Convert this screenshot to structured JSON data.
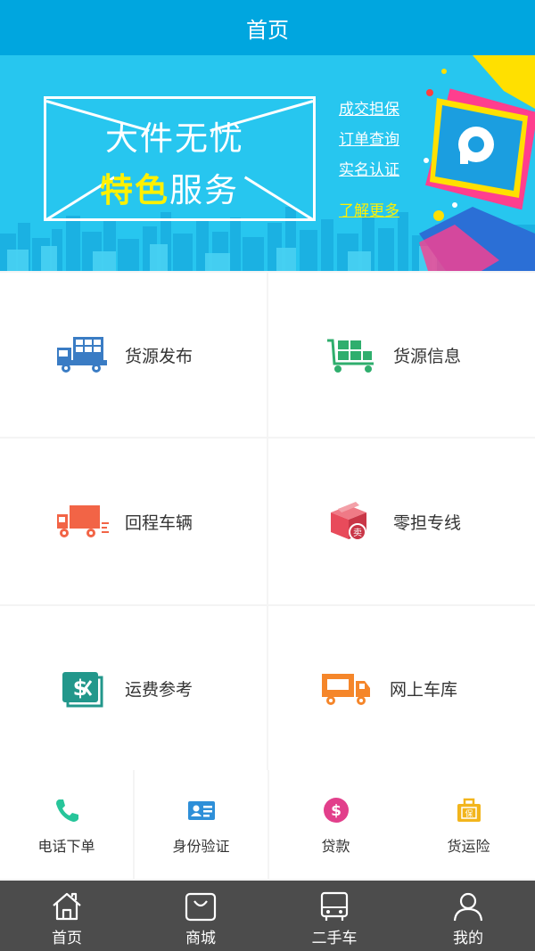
{
  "header": {
    "title": "首页"
  },
  "banner": {
    "title": "大件无忧",
    "subtitle_highlight": "特色",
    "subtitle_rest": "服务",
    "links": [
      "成交担保",
      "订单查询",
      "实名认证"
    ],
    "more": "了解更多"
  },
  "services": [
    {
      "label": "货源发布",
      "icon": "truck-cargo-icon",
      "color": "#3a7cc4"
    },
    {
      "label": "货源信息",
      "icon": "cart-boxes-icon",
      "color": "#2fae6d"
    },
    {
      "label": "回程车辆",
      "icon": "return-truck-icon",
      "color": "#f26446"
    },
    {
      "label": "零担专线",
      "icon": "sell-box-icon",
      "color": "#e84b5b"
    },
    {
      "label": "运费参考",
      "icon": "freight-price-icon",
      "color": "#22978b"
    },
    {
      "label": "网上车库",
      "icon": "orange-truck-icon",
      "color": "#f5862a"
    }
  ],
  "quick": [
    {
      "label": "电话下单",
      "icon": "phone-icon",
      "color": "#27c59a"
    },
    {
      "label": "身份验证",
      "icon": "id-card-icon",
      "color": "#2e8fd8"
    },
    {
      "label": "贷款",
      "icon": "dollar-coin-icon",
      "color": "#e23f8b"
    },
    {
      "label": "货运险",
      "icon": "insurance-bag-icon",
      "color": "#f2b51c"
    }
  ],
  "tabs": [
    {
      "label": "首页",
      "icon": "home-icon"
    },
    {
      "label": "商城",
      "icon": "shop-bag-icon"
    },
    {
      "label": "二手车",
      "icon": "bus-icon"
    },
    {
      "label": "我的",
      "icon": "user-icon"
    }
  ]
}
